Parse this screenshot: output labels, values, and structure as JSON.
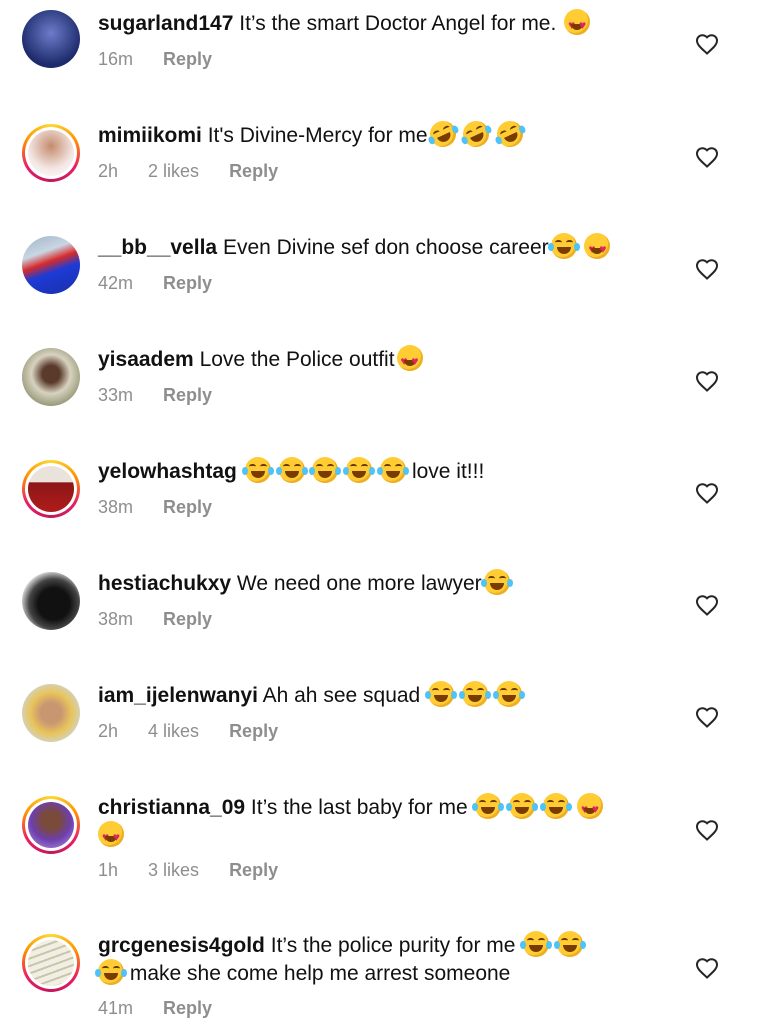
{
  "comments": [
    {
      "username": "sugarland147",
      "text": "It’s the smart Doctor Angel for me.",
      "emojis": [
        "heart-eyes"
      ],
      "time": "16m",
      "likes": "",
      "reply": "Reply"
    },
    {
      "username": "mimiikomi",
      "text": "It's Divine-Mercy for me",
      "emojis": [
        "rofl",
        "rofl",
        "rofl"
      ],
      "time": "2h",
      "likes": "2 likes",
      "reply": "Reply"
    },
    {
      "username": "__bb__vella",
      "text": "Even Divine sef don choose career",
      "emojis": [
        "laugh",
        "heart-eyes"
      ],
      "time": "42m",
      "likes": "",
      "reply": "Reply"
    },
    {
      "username": "yisaadem",
      "text": "Love the Police outfit",
      "emojis": [
        "heart-eyes"
      ],
      "time": "33m",
      "likes": "",
      "reply": "Reply"
    },
    {
      "username": "yelowhashtag",
      "text": "",
      "emojis": [
        "laugh",
        "laugh",
        "laugh",
        "laugh",
        "laugh"
      ],
      "text_after": "love it!!!",
      "time": "38m",
      "likes": "",
      "reply": "Reply"
    },
    {
      "username": "hestiachukxy",
      "text": "We need one more lawyer",
      "emojis": [
        "laugh"
      ],
      "time": "38m",
      "likes": "",
      "reply": "Reply"
    },
    {
      "username": "iam_ijelenwanyi",
      "text": "Ah ah see squad",
      "emojis": [
        "laugh",
        "laugh",
        "laugh"
      ],
      "time": "2h",
      "likes": "4 likes",
      "reply": "Reply"
    },
    {
      "username": "christianna_09",
      "text": "It’s the last baby for me",
      "emojis": [
        "laugh",
        "laugh",
        "laugh",
        "heart-eyes",
        "heart-eyes"
      ],
      "time": "1h",
      "likes": "3 likes",
      "reply": "Reply"
    },
    {
      "username": "grcgenesis4gold",
      "text": "It’s the police purity for me",
      "emojis": [
        "laugh",
        "laugh",
        "laugh"
      ],
      "text_after": "make she come help me arrest someone",
      "time": "41m",
      "likes": "",
      "reply": "Reply"
    }
  ],
  "icons": {
    "like": "heart-outline-icon"
  },
  "colors": {
    "meta": "#8e8e8e",
    "story_ring": "#e91e63"
  }
}
